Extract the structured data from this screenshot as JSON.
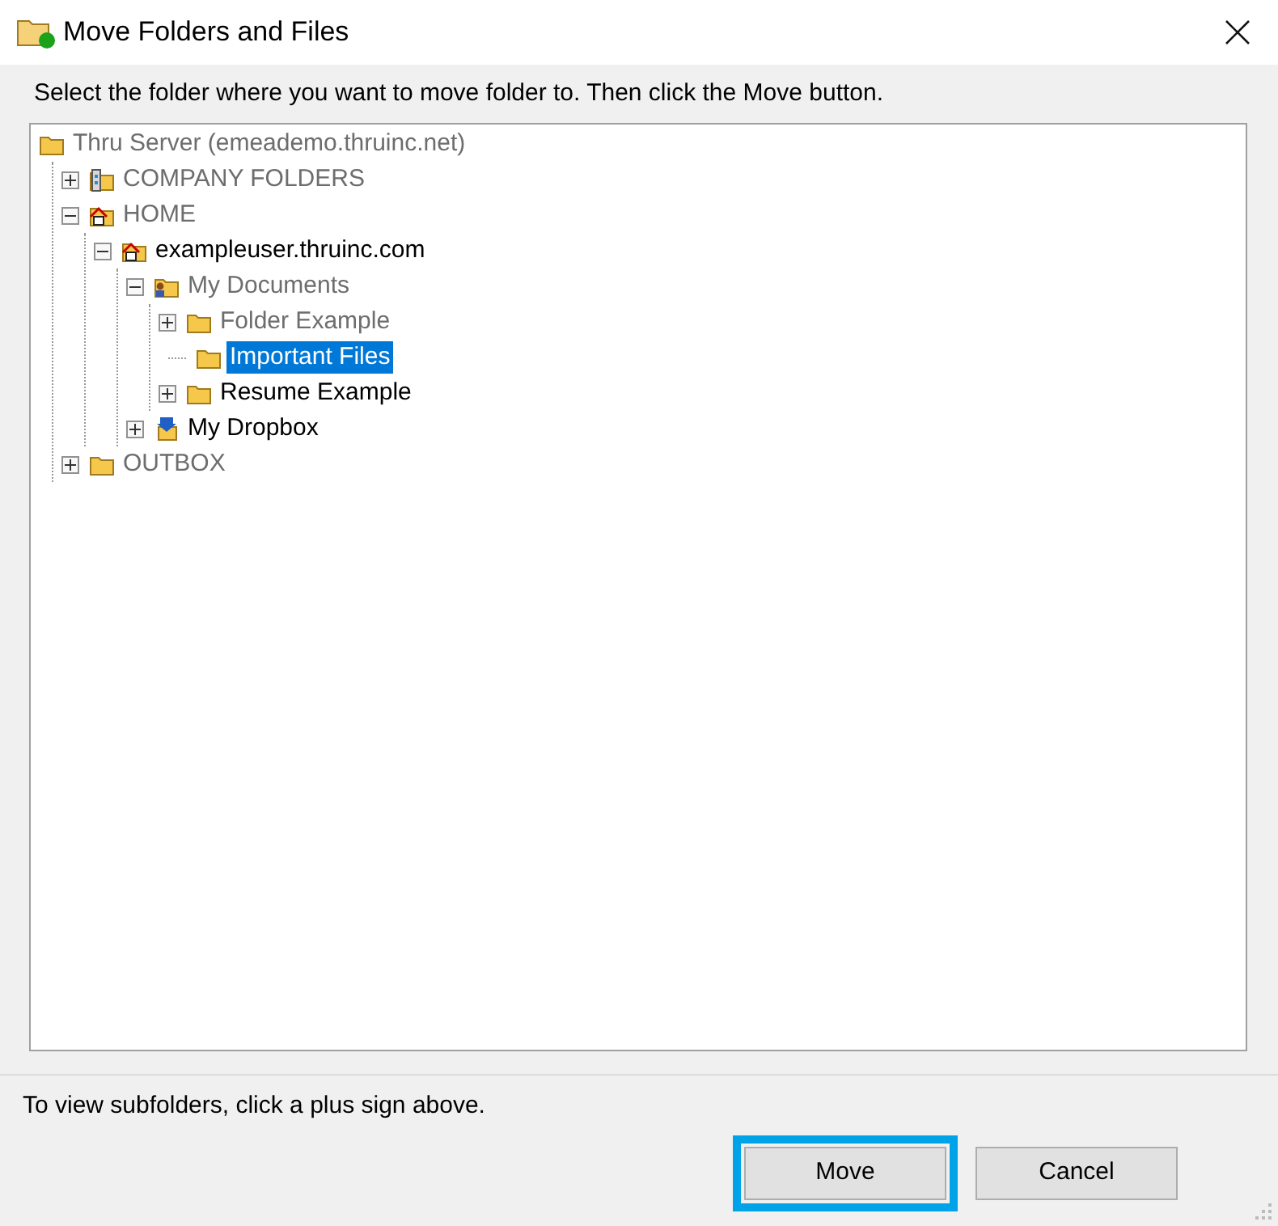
{
  "window": {
    "title": "Move Folders and Files"
  },
  "instruction": "Select the folder where you want to move folder to. Then click the Move button.",
  "tree": [
    {
      "label": "Thru Server (emeademo.thruinc.net)",
      "kind": "folder",
      "dimmed": true,
      "selected": false,
      "children": [
        {
          "label": "COMPANY FOLDERS",
          "kind": "shared",
          "dimmed": true,
          "selected": false,
          "expanded": false
        },
        {
          "label": "HOME",
          "kind": "home",
          "dimmed": true,
          "selected": false,
          "expanded": true,
          "children": [
            {
              "label": "exampleuser.thruinc.com",
              "kind": "home",
              "dimmed": false,
              "selected": false,
              "expanded": true,
              "children": [
                {
                  "label": "My Documents",
                  "kind": "user",
                  "dimmed": true,
                  "selected": false,
                  "expanded": true,
                  "children": [
                    {
                      "label": "Folder Example",
                      "kind": "folder",
                      "dimmed": true,
                      "selected": false,
                      "expanded": false
                    },
                    {
                      "label": "Important Files",
                      "kind": "folder",
                      "selected": true
                    },
                    {
                      "label": "Resume Example",
                      "kind": "folder",
                      "dimmed": false,
                      "selected": false,
                      "expanded": false
                    }
                  ]
                },
                {
                  "label": "My Dropbox",
                  "kind": "dropbox",
                  "dimmed": false,
                  "selected": false,
                  "expanded": false
                }
              ]
            }
          ]
        },
        {
          "label": "OUTBOX",
          "kind": "folder",
          "dimmed": true,
          "selected": false,
          "expanded": false
        }
      ]
    }
  ],
  "hint": "To view subfolders, click a plus sign above.",
  "buttons": [
    {
      "label": "Move",
      "focused": true
    },
    {
      "label": "Cancel",
      "focused": false
    }
  ]
}
